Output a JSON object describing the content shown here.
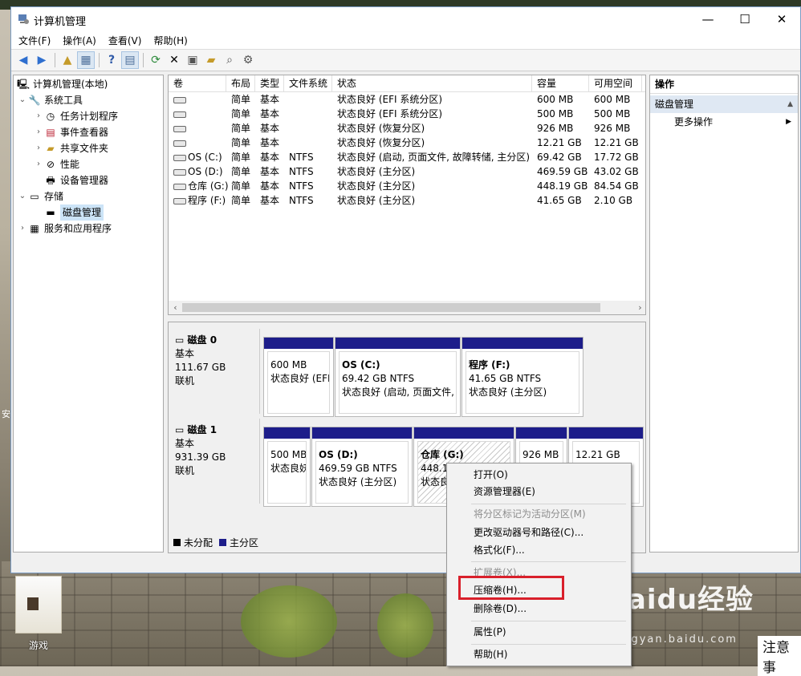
{
  "window": {
    "title": "计算机管理",
    "controls": {
      "minimize": "—",
      "maximize": "☐",
      "close": "✕"
    }
  },
  "menubar": [
    "文件(F)",
    "操作(A)",
    "查看(V)",
    "帮助(H)"
  ],
  "tree": {
    "root": "计算机管理(本地)",
    "system_tools": "系统工具",
    "items": [
      "任务计划程序",
      "事件查看器",
      "共享文件夹",
      "性能",
      "设备管理器"
    ],
    "storage": "存储",
    "disk_mgmt": "磁盘管理",
    "services": "服务和应用程序"
  },
  "volume_table": {
    "headers": [
      "卷",
      "布局",
      "类型",
      "文件系统",
      "状态",
      "容量",
      "可用空间"
    ],
    "rows": [
      [
        "",
        "简单",
        "基本",
        "",
        "状态良好 (EFI 系统分区)",
        "600 MB",
        "600 MB"
      ],
      [
        "",
        "简单",
        "基本",
        "",
        "状态良好 (EFI 系统分区)",
        "500 MB",
        "500 MB"
      ],
      [
        "",
        "简单",
        "基本",
        "",
        "状态良好 (恢复分区)",
        "926 MB",
        "926 MB"
      ],
      [
        "",
        "简单",
        "基本",
        "",
        "状态良好 (恢复分区)",
        "12.21 GB",
        "12.21 GB"
      ],
      [
        "OS (C:)",
        "简单",
        "基本",
        "NTFS",
        "状态良好 (启动, 页面文件, 故障转储, 主分区)",
        "69.42 GB",
        "17.72 GB"
      ],
      [
        "OS (D:)",
        "简单",
        "基本",
        "NTFS",
        "状态良好 (主分区)",
        "469.59 GB",
        "43.02 GB"
      ],
      [
        "仓库 (G:)",
        "简单",
        "基本",
        "NTFS",
        "状态良好 (主分区)",
        "448.19 GB",
        "84.54 GB"
      ],
      [
        "程序 (F:)",
        "简单",
        "基本",
        "NTFS",
        "状态良好 (主分区)",
        "41.65 GB",
        "2.10 GB"
      ]
    ]
  },
  "disks": [
    {
      "name": "磁盘 0",
      "type": "基本",
      "size": "111.67 GB",
      "state": "联机",
      "parts": [
        {
          "name": "",
          "size": "600 MB",
          "status": "状态良好 (EFI"
        },
        {
          "name": "OS  (C:)",
          "size": "69.42 GB NTFS",
          "status": "状态良好 (启动, 页面文件,"
        },
        {
          "name": "程序  (F:)",
          "size": "41.65 GB NTFS",
          "status": "状态良好 (主分区)"
        }
      ]
    },
    {
      "name": "磁盘 1",
      "type": "基本",
      "size": "931.39 GB",
      "state": "联机",
      "parts": [
        {
          "name": "",
          "size": "500 MB",
          "status": "状态良妖"
        },
        {
          "name": "OS  (D:)",
          "size": "469.59 GB NTFS",
          "status": "状态良好 (主分区)"
        },
        {
          "name": "仓库  (G:)",
          "size": "448.19 GB NTFS",
          "status": "状态良"
        },
        {
          "name": "",
          "size": "926 MB",
          "status": ""
        },
        {
          "name": "",
          "size": "12.21 GB",
          "status": "康"
        }
      ]
    }
  ],
  "legend": {
    "unallocated": "未分配",
    "primary": "主分区",
    "unallocated_color": "#000000",
    "primary_color": "#1d1d8a"
  },
  "actions": {
    "header": "操作",
    "section": "磁盘管理",
    "more": "更多操作"
  },
  "context_menu": {
    "items": [
      {
        "label": "打开(O)",
        "enabled": true
      },
      {
        "label": "资源管理器(E)",
        "enabled": true
      },
      {
        "label": "将分区标记为活动分区(M)",
        "enabled": false
      },
      {
        "label": "更改驱动器号和路径(C)...",
        "enabled": true
      },
      {
        "label": "格式化(F)...",
        "enabled": true
      },
      {
        "label": "扩展卷(X)...",
        "enabled": false
      },
      {
        "label": "压缩卷(H)...",
        "enabled": true,
        "highlighted": true
      },
      {
        "label": "删除卷(D)...",
        "enabled": true
      },
      {
        "label": "属性(P)",
        "enabled": true
      },
      {
        "label": "帮助(H)",
        "enabled": true
      }
    ],
    "highlight_color": "#d9202b"
  },
  "desktop": {
    "folder_label": "游戏",
    "watermark": "Baidu经验",
    "watermark_sub": "jingyan.baidu.com",
    "side_note": "注意事",
    "side_char": "安"
  }
}
